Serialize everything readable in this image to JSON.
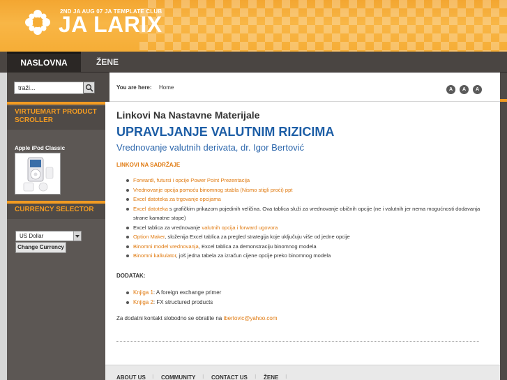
{
  "header": {
    "tagline": "2ND JA AUG 07 JA TEMPLATE CLUB",
    "logo_text": "JA LARIX"
  },
  "nav": {
    "tabs": [
      {
        "label": "NASLOVNA",
        "active": true
      },
      {
        "label": "ŽENE",
        "active": false
      }
    ]
  },
  "sidebar": {
    "search": {
      "value": "traži..."
    },
    "virtuemart_title": "VIRTUEMART PRODUCT SCROLLER",
    "product_name": "Apple iPod Classic",
    "currency_title": "CURRENCY SELECTOR",
    "currency_selected": "US Dollar",
    "currency_button": "Change Currency"
  },
  "breadcrumb": {
    "label": "You are here:",
    "home": "Home",
    "font_sizes": [
      "A",
      "A",
      "A"
    ]
  },
  "article": {
    "title": "Linkovi Na Nastavne Materijale",
    "h1": "UPRAVLJANJE VALUTNIM RIZICIMA",
    "h2": "Vrednovanje valutnih derivata, dr. Igor Bertović",
    "section_label": "LINKOVI NA SADRŽAJE",
    "links": [
      {
        "link": "Forwardi, futursi i opcije Power Point Prezentacija",
        "text": ""
      },
      {
        "link": "Vrednovanje opcija pomoću binomnog stabla (Nismo stigli proći) ppt",
        "text": ""
      },
      {
        "link": "Excel datoteka za trgovanje opcijama",
        "text": ""
      },
      {
        "link": "Excel datoteka",
        "text": " s grafičkim prikazom pojedinih veličina. Ova tablica služi za vrednovanje običnih opcije (ne i valutnih jer nema mogućnosti dodavanja strane kamatne stope)"
      },
      {
        "pre": "Excel tablica za vrednovanje ",
        "link": "valutnih opcija i forward ugovora",
        "text": ""
      },
      {
        "link": "Option Maker",
        "text": ", složenija Excel tablica za pregled strategija koje uključuju više od jedne opcije"
      },
      {
        "link": "Binomni model vrednovanja",
        "text": ", Excel tablica za demonstraciju binomnog modela"
      },
      {
        "link": "Binomni kalkulator",
        "text": ", još jedna tabela za izračun cijene opcije preko binomnog modela"
      }
    ],
    "addendum_label": "DODATAK:",
    "addendum": [
      {
        "link": "Knjiga 1",
        "text": ": A foreign exchange primer"
      },
      {
        "link": "Knjiga 2",
        "text": ": FX structured products"
      }
    ],
    "contact_text": "Za dodatni kontakt slobodno se obratite na ",
    "contact_email": "ibertovic@yahoo.com"
  },
  "footer": {
    "links": [
      "ABOUT US",
      "COMMUNITY",
      "CONTACT US",
      "ŽENE"
    ]
  },
  "colors": {
    "accent": "#f29b22",
    "link": "#e07a10",
    "heading_blue": "#1d5ea6",
    "dark": "#4f4a47"
  }
}
